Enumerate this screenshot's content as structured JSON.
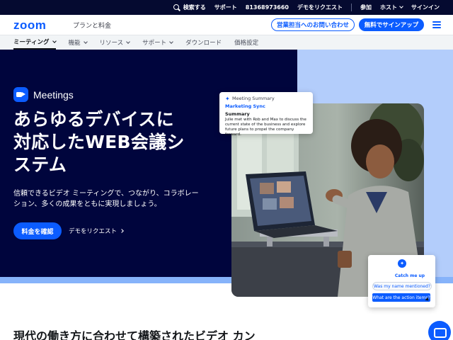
{
  "topbar": {
    "search": "検索する",
    "support": "サポート",
    "phone": "81368973660",
    "demo": "デモをリクエスト",
    "join": "参加",
    "host": "ホスト",
    "signin": "サインイン"
  },
  "header": {
    "logo": "zoom",
    "plans": "プランと料金",
    "contact_sales": "営業担当へのお問い合わせ",
    "signup_free": "無料でサインアップ"
  },
  "nav": {
    "items": [
      {
        "label": "ミーティング"
      },
      {
        "label": "機能"
      },
      {
        "label": "リソース"
      },
      {
        "label": "サポート"
      },
      {
        "label": "ダウンロード"
      },
      {
        "label": "価格設定"
      }
    ]
  },
  "hero": {
    "badge": "Meetings",
    "title_line1": "あらゆるデバイスに",
    "title_line2": "対応したWEB会議シ",
    "title_line3": "ステム",
    "desc": "信頼できるビデオ ミーティングで、つながり、コラボレーション、多くの成果をともに実現しましょう。",
    "cta_primary": "料金を確認",
    "cta_secondary": "デモをリクエスト"
  },
  "summary_card": {
    "head": "Meeting Summary",
    "title": "Marketing Sync",
    "sub": "Summary",
    "body": "Julie met with Rob and Max to discuss the current state of the business and explore future plans to propel the company forward."
  },
  "ai_card": {
    "chip1": "Catch me up",
    "chip2": "Was my name mentioned?",
    "chip3": "What are the action items?"
  },
  "section": {
    "heading": "現代の働き方に合わせて構築されたビデオ カン"
  },
  "colors": {
    "brand_blue": "#0b5cff",
    "hero_dark": "#00053d",
    "hero_light": "#b3cdfb",
    "topbar_bg": "#050a30"
  }
}
